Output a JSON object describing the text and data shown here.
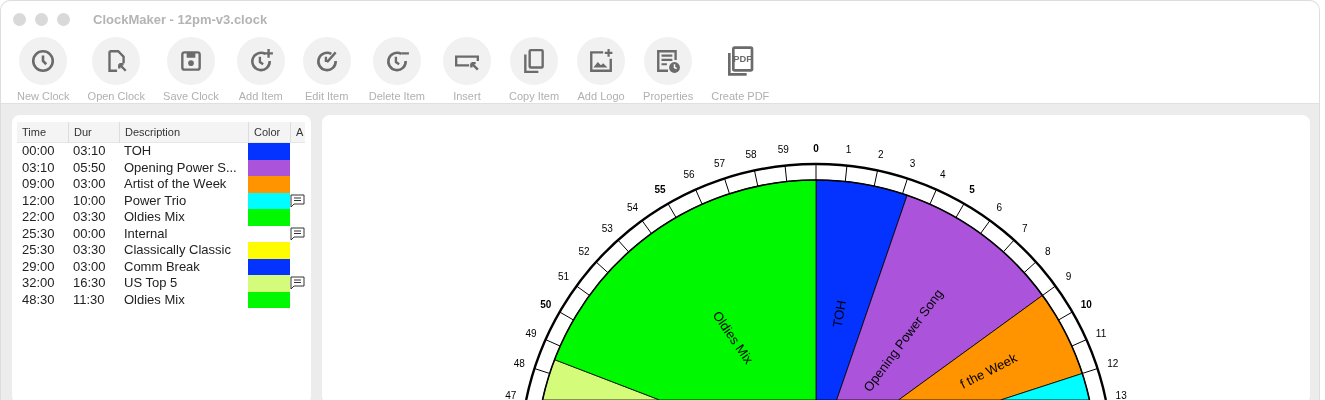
{
  "window": {
    "title": "ClockMaker - 12pm-v3.clock"
  },
  "toolbar": [
    {
      "label": "New Clock",
      "kind": "round"
    },
    {
      "label": "Open Clock",
      "kind": "round"
    },
    {
      "label": "Save Clock",
      "kind": "round"
    },
    {
      "label": "Add Item",
      "kind": "round"
    },
    {
      "label": "Edit Item",
      "kind": "round"
    },
    {
      "label": "Delete Item",
      "kind": "round"
    },
    {
      "label": "Insert",
      "kind": "round"
    },
    {
      "label": "Copy Item",
      "kind": "round"
    },
    {
      "label": "Add Logo",
      "kind": "round"
    },
    {
      "label": "Properties",
      "kind": "round"
    },
    {
      "label": "Create PDF",
      "badge": "PDF",
      "kind": "plain"
    }
  ],
  "table": {
    "columns": [
      "Time",
      "Dur",
      "Description",
      "Color",
      "A"
    ],
    "rows": [
      {
        "time": "00:00",
        "dur": "03:10",
        "description": "TOH",
        "color": "#0433ff",
        "note": false,
        "clock_label": "TOH"
      },
      {
        "time": "03:10",
        "dur": "05:50",
        "description": "Opening Power S...",
        "color": "#ac53dc",
        "note": false,
        "clock_label": "Opening Power Song"
      },
      {
        "time": "09:00",
        "dur": "03:00",
        "description": "Artist of the Week",
        "color": "#ff9300",
        "note": false,
        "clock_label": "f the Week"
      },
      {
        "time": "12:00",
        "dur": "10:00",
        "description": "Power Trio",
        "color": "#00fdff",
        "note": true
      },
      {
        "time": "22:00",
        "dur": "03:30",
        "description": "Oldies Mix",
        "color": "#00f900",
        "note": false
      },
      {
        "time": "25:30",
        "dur": "00:00",
        "description": "Internal",
        "note": true
      },
      {
        "time": "25:30",
        "dur": "03:30",
        "description": "Classically Classic",
        "color": "#fffb00",
        "note": false
      },
      {
        "time": "29:00",
        "dur": "03:00",
        "description": "Comm Break",
        "color": "#0433ff",
        "note": false
      },
      {
        "time": "32:00",
        "dur": "16:30",
        "description": "US Top 5",
        "color": "#d4fb79",
        "note": true
      },
      {
        "time": "48:30",
        "dur": "11:30",
        "description": "Oldies Mix",
        "color": "#00f900",
        "note": false,
        "clock_label": "Oldies Mix"
      }
    ]
  },
  "clock": {
    "minute_labels": [
      "47",
      "48",
      "49",
      "50",
      "51",
      "52",
      "53",
      "54",
      "55",
      "56",
      "57",
      "58",
      "59",
      "0",
      "1",
      "2",
      "3",
      "4",
      "5",
      "6",
      "7",
      "8",
      "9",
      "10",
      "11",
      "12",
      "13"
    ]
  }
}
